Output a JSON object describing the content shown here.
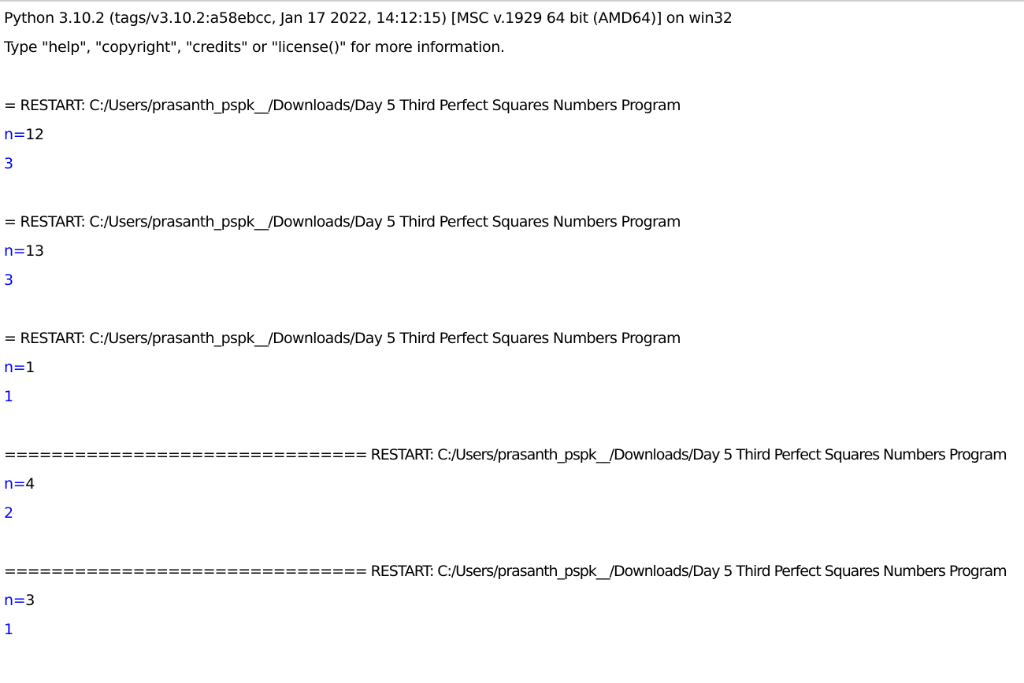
{
  "shell": {
    "header": {
      "version_line": "Python 3.10.2 (tags/v3.10.2:a58ebcc, Jan 17 2022, 14:12:15) [MSC v.1929 64 bit (AMD64)] on win32",
      "help_line": "Type \"help\", \"copyright\", \"credits\" or \"license()\" for more information."
    },
    "runs": [
      {
        "restart_line": "= RESTART: C:/Users/prasanth_pspk__/Downloads/Day 5 Third Perfect Squares Numbers Program",
        "prompt": "n=",
        "input": "12",
        "output": "3"
      },
      {
        "restart_line": "= RESTART: C:/Users/prasanth_pspk__/Downloads/Day 5 Third Perfect Squares Numbers Program",
        "prompt": "n=",
        "input": "13",
        "output": "3"
      },
      {
        "restart_line": "= RESTART: C:/Users/prasanth_pspk__/Downloads/Day 5 Third Perfect Squares Numbers Program",
        "prompt": "n=",
        "input": "1",
        "output": "1"
      },
      {
        "restart_line": "=============================== RESTART: C:/Users/prasanth_pspk__/Downloads/Day 5 Third Perfect Squares Numbers Program",
        "prompt": "n=",
        "input": "4",
        "output": "2"
      },
      {
        "restart_line": "=============================== RESTART: C:/Users/prasanth_pspk__/Downloads/Day 5 Third Perfect Squares Numbers Program",
        "prompt": "n=",
        "input": "3",
        "output": "1"
      }
    ],
    "colors": {
      "background": "#ffffff",
      "text": "#000000",
      "stdout_blue": "#0000ff",
      "top_border": "#cfcfcf"
    }
  }
}
